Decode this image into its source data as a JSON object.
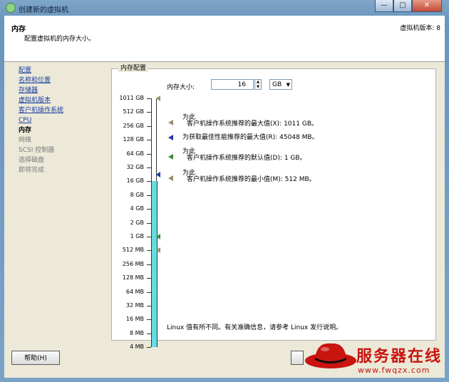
{
  "window": {
    "title": "创建新的虚拟机",
    "minimize": "—",
    "maximize": "□",
    "close": "✕"
  },
  "header": {
    "title": "内存",
    "subtitle": "配置虚拟机的内存大小。",
    "version": "虚拟机版本: 8"
  },
  "steps": [
    {
      "label": "配置",
      "state": "link"
    },
    {
      "label": "名称和位置",
      "state": "link"
    },
    {
      "label": "存储器",
      "state": "link"
    },
    {
      "label": "虚拟机版本",
      "state": "link"
    },
    {
      "label": "客户机操作系统",
      "state": "link"
    },
    {
      "label": "CPU",
      "state": "link"
    },
    {
      "label": "内存",
      "state": "current"
    },
    {
      "label": "网络",
      "state": "future"
    },
    {
      "label": "SCSI 控制器",
      "state": "future"
    },
    {
      "label": "选择磁盘",
      "state": "future"
    },
    {
      "label": "即将完成",
      "state": "future"
    }
  ],
  "memory_group": {
    "label": "内存配置",
    "size_label": "内存大小:",
    "size_value": "16",
    "unit_value": "GB",
    "scale": [
      "1011 GB",
      "512 GB",
      "256 GB",
      "128 GB",
      "64 GB",
      "32 GB",
      "16 GB",
      "8 GB",
      "4 GB",
      "2 GB",
      "1 GB",
      "512 MB",
      "256 MB",
      "128 MB",
      "64 MB",
      "32 MB",
      "16 MB",
      "8 MB",
      "4 MB"
    ],
    "recommendations": [
      {
        "prefix": "为此",
        "text": "客户机操作系统推荐的最大值(X): 1011 GB。",
        "color": "#9a8f6a"
      },
      {
        "prefix": "",
        "text": "为获取最佳性能推荐的最大值(R): 45048 MB。",
        "color": "#1e3aa0"
      },
      {
        "prefix": "为此",
        "text": "客户机操作系统推荐的默认值(D): 1 GB。",
        "color": "#3e8c3a"
      },
      {
        "prefix": "为此",
        "text": "客户机操作系统推荐的最小值(M): 512 MB。",
        "color": "#9a8f6a"
      }
    ],
    "note": "Linux 值有所不同。有关准确信息，请参考 Linux 发行说明。"
  },
  "buttons": {
    "help": "帮助(H)"
  },
  "watermark": {
    "brand": "服务器在线",
    "url": "www.fwqzx.com"
  },
  "colors": {
    "bar_fill": "#66dbe0",
    "link": "#1c3fa8",
    "logo_red": "#c9140f"
  }
}
